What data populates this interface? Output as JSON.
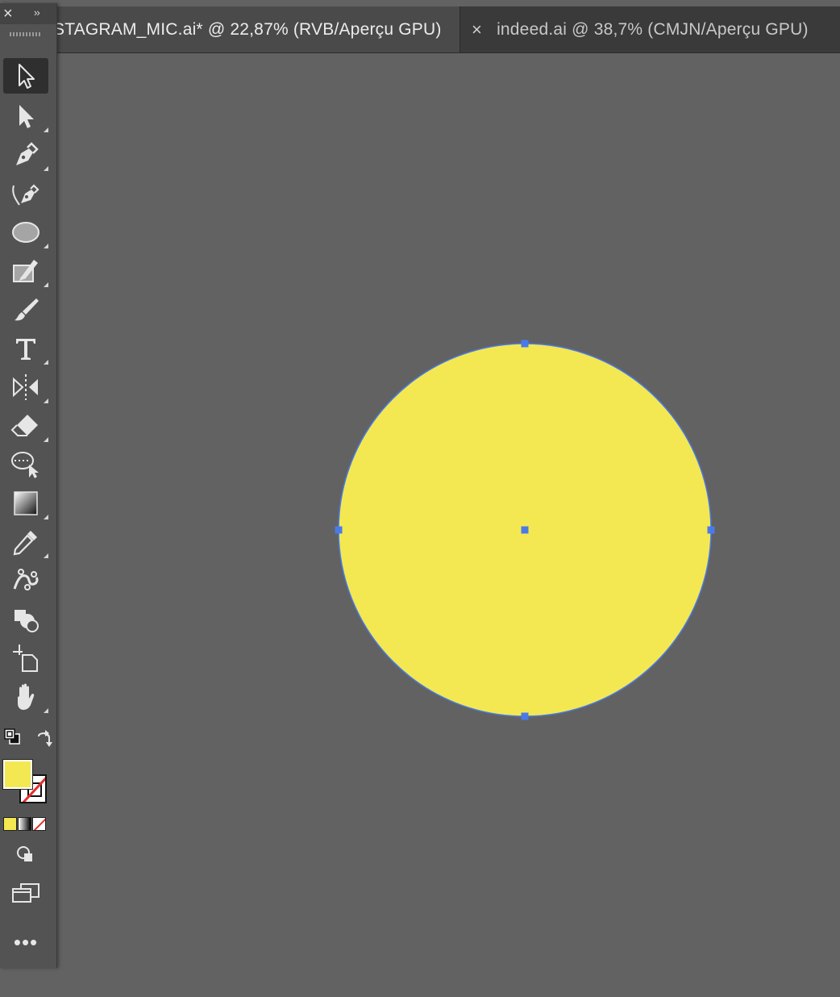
{
  "tabs": [
    {
      "label": "STAGRAM_MIC.ai* @ 22,87% (RVB/Aperçu GPU)",
      "active": true
    },
    {
      "label": "indeed.ai @ 38,7% (CMJN/Aperçu GPU)",
      "active": false,
      "close_glyph": "×"
    }
  ],
  "panel": {
    "close_glyph": "×",
    "collapse_glyph": "››",
    "more_glyph": "•••"
  },
  "tools": [
    {
      "name": "selection-tool",
      "icon": "selection-arrow-icon",
      "selected": true
    },
    {
      "name": "direct-selection-tool",
      "icon": "direct-selection-icon"
    },
    {
      "name": "pen-tool",
      "icon": "pen-icon"
    },
    {
      "name": "curvature-tool",
      "icon": "curvature-icon"
    },
    {
      "name": "ellipse-tool",
      "icon": "ellipse-icon"
    },
    {
      "name": "shaper-tool",
      "icon": "shaper-icon"
    },
    {
      "name": "paintbrush-tool",
      "icon": "paintbrush-icon"
    },
    {
      "name": "type-tool",
      "icon": "type-icon"
    },
    {
      "name": "reflect-tool",
      "icon": "reflect-icon"
    },
    {
      "name": "eraser-tool",
      "icon": "eraser-icon"
    },
    {
      "name": "lasso-tool",
      "icon": "lasso-icon"
    },
    {
      "name": "gradient-tool",
      "icon": "gradient-icon"
    },
    {
      "name": "eyedropper-tool",
      "icon": "eyedropper-icon"
    },
    {
      "name": "puppet-warp-tool",
      "icon": "puppet-warp-icon"
    },
    {
      "name": "shape-builder-tool",
      "icon": "shape-builder-icon"
    },
    {
      "name": "artboard-tool",
      "icon": "artboard-icon"
    },
    {
      "name": "hand-tool",
      "icon": "hand-icon"
    }
  ],
  "colors": {
    "fill": "#f3e852",
    "stroke": "none",
    "selection": "#4a7ae8",
    "canvas": "#626262"
  },
  "artwork": {
    "shape": "circle",
    "fill": "#f3e852",
    "selected": true
  }
}
